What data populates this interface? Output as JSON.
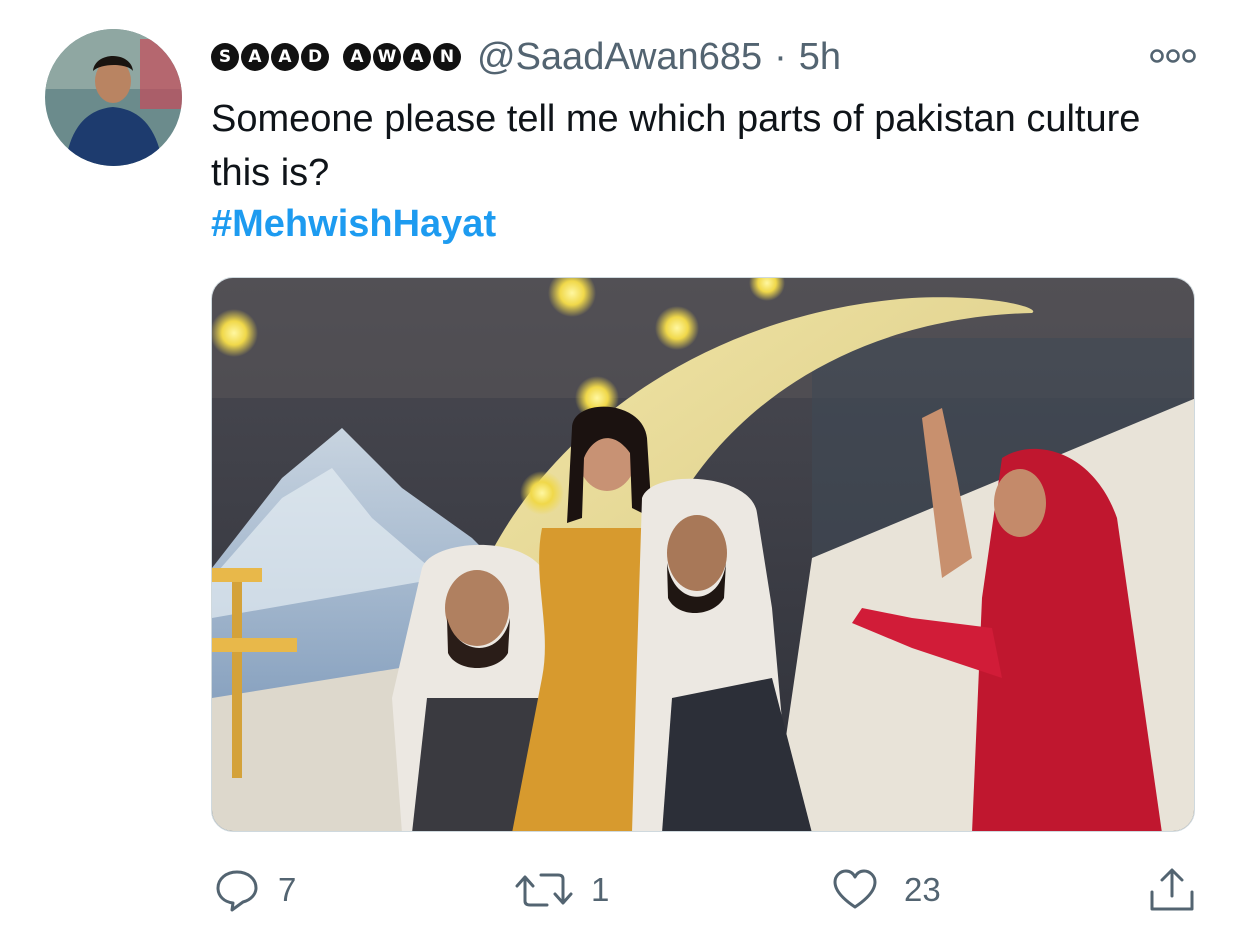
{
  "tweet": {
    "author_name_words": [
      "SAAD",
      "AWAN"
    ],
    "handle": "@SaadAwan685",
    "separator": "·",
    "time": "5h",
    "text": "Someone please tell me which parts of pakistan culture this is?",
    "hashtag": "#MehwishHayat"
  },
  "actions": {
    "reply_count": "7",
    "retweet_count": "1",
    "like_count": "23"
  },
  "icons": {
    "more": "more-options-icon",
    "reply": "reply-icon",
    "retweet": "retweet-icon",
    "like": "heart-icon",
    "share": "share-icon"
  },
  "colors": {
    "text": "#0f1419",
    "secondary": "#536471",
    "link": "#1d9bf0"
  }
}
